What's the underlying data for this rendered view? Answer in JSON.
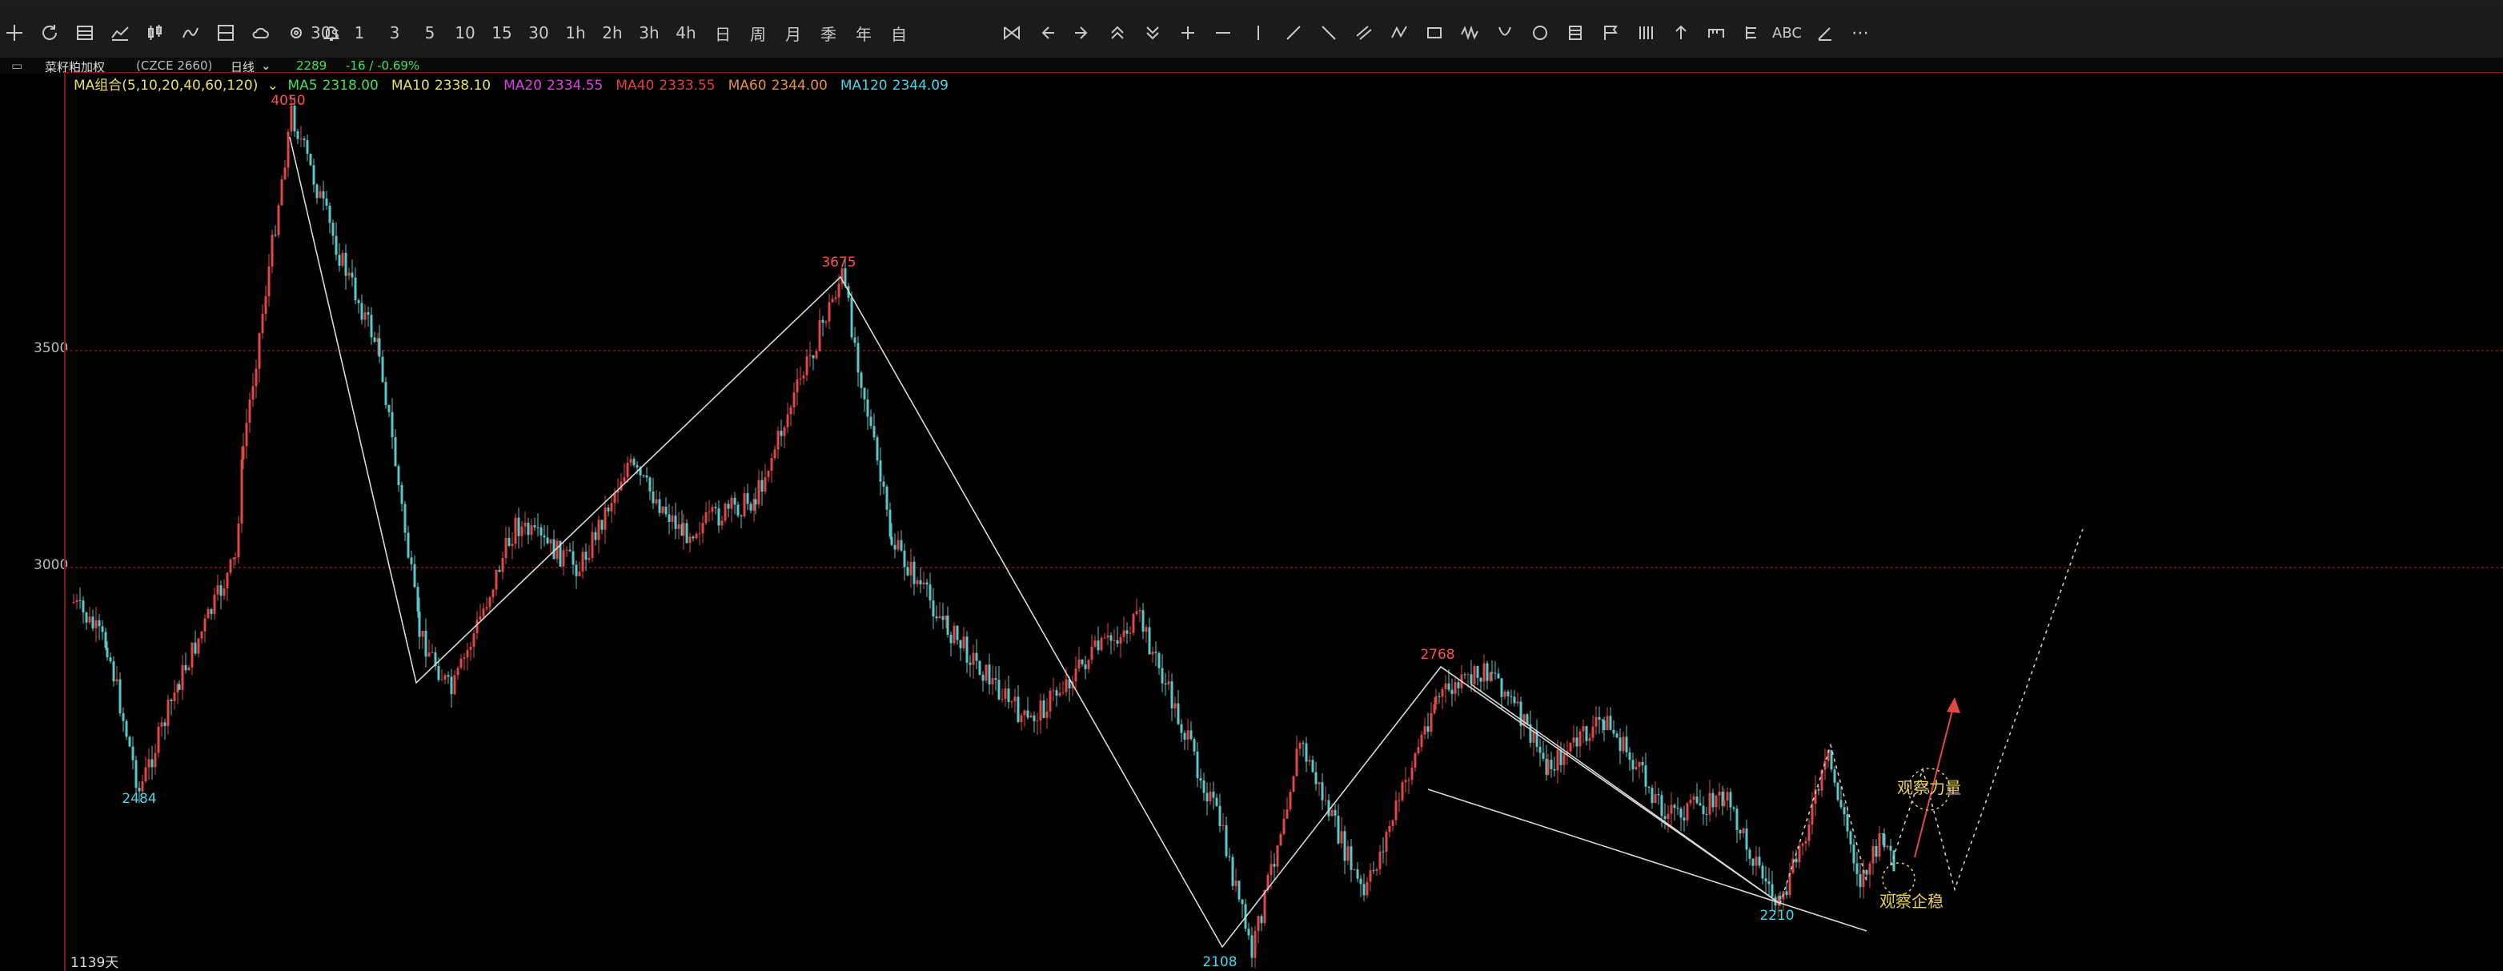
{
  "toolbar": {
    "periods": [
      "30s",
      "1",
      "3",
      "5",
      "10",
      "15",
      "30",
      "1h",
      "2h",
      "3h",
      "4h",
      "日",
      "周",
      "月",
      "季",
      "年",
      "自"
    ],
    "text_tools": [
      "ABC"
    ]
  },
  "infobar": {
    "symbol": "菜籽粕加权",
    "code": "(CZCE 2660)",
    "period": "日线",
    "price": "2289",
    "change": "-16 / -0.69%"
  },
  "ma_legend": {
    "label": "MA组合(5,10,20,40,60,120)",
    "items": [
      {
        "name": "MA5",
        "value": "2318.00",
        "color": "#3ee05a"
      },
      {
        "name": "MA10",
        "value": "2338.10",
        "color": "#e8e05a"
      },
      {
        "name": "MA20",
        "value": "2334.55",
        "color": "#e040e0"
      },
      {
        "name": "MA40",
        "value": "2333.55",
        "color": "#e04040"
      },
      {
        "name": "MA60",
        "value": "2344.00",
        "color": "#e89040"
      },
      {
        "name": "MA120",
        "value": "2344.09",
        "color": "#40d8e8"
      }
    ]
  },
  "axis": {
    "levels": [
      "3500",
      "3000"
    ]
  },
  "day_count": "1139天",
  "chart_data": {
    "type": "candlestick",
    "title": "",
    "y_levels": [
      3500,
      3000
    ],
    "pivots": [
      {
        "label": "2484",
        "value": 2484,
        "kind": "low"
      },
      {
        "label": "4050",
        "value": 4050,
        "kind": "high"
      },
      {
        "label": "3675",
        "value": 3675,
        "kind": "high"
      },
      {
        "label": "2108",
        "value": 2108,
        "kind": "low"
      },
      {
        "label": "2768",
        "value": 2768,
        "kind": "high"
      },
      {
        "label": "2210",
        "value": 2210,
        "kind": "low"
      }
    ],
    "annotations": [
      "观察力量",
      "观察企稳"
    ]
  },
  "colors": {
    "up": "#e04848",
    "down": "#5ac8c8",
    "high_label": "#ff5050",
    "low_label": "#40d8e8",
    "note": "#e8d050"
  }
}
